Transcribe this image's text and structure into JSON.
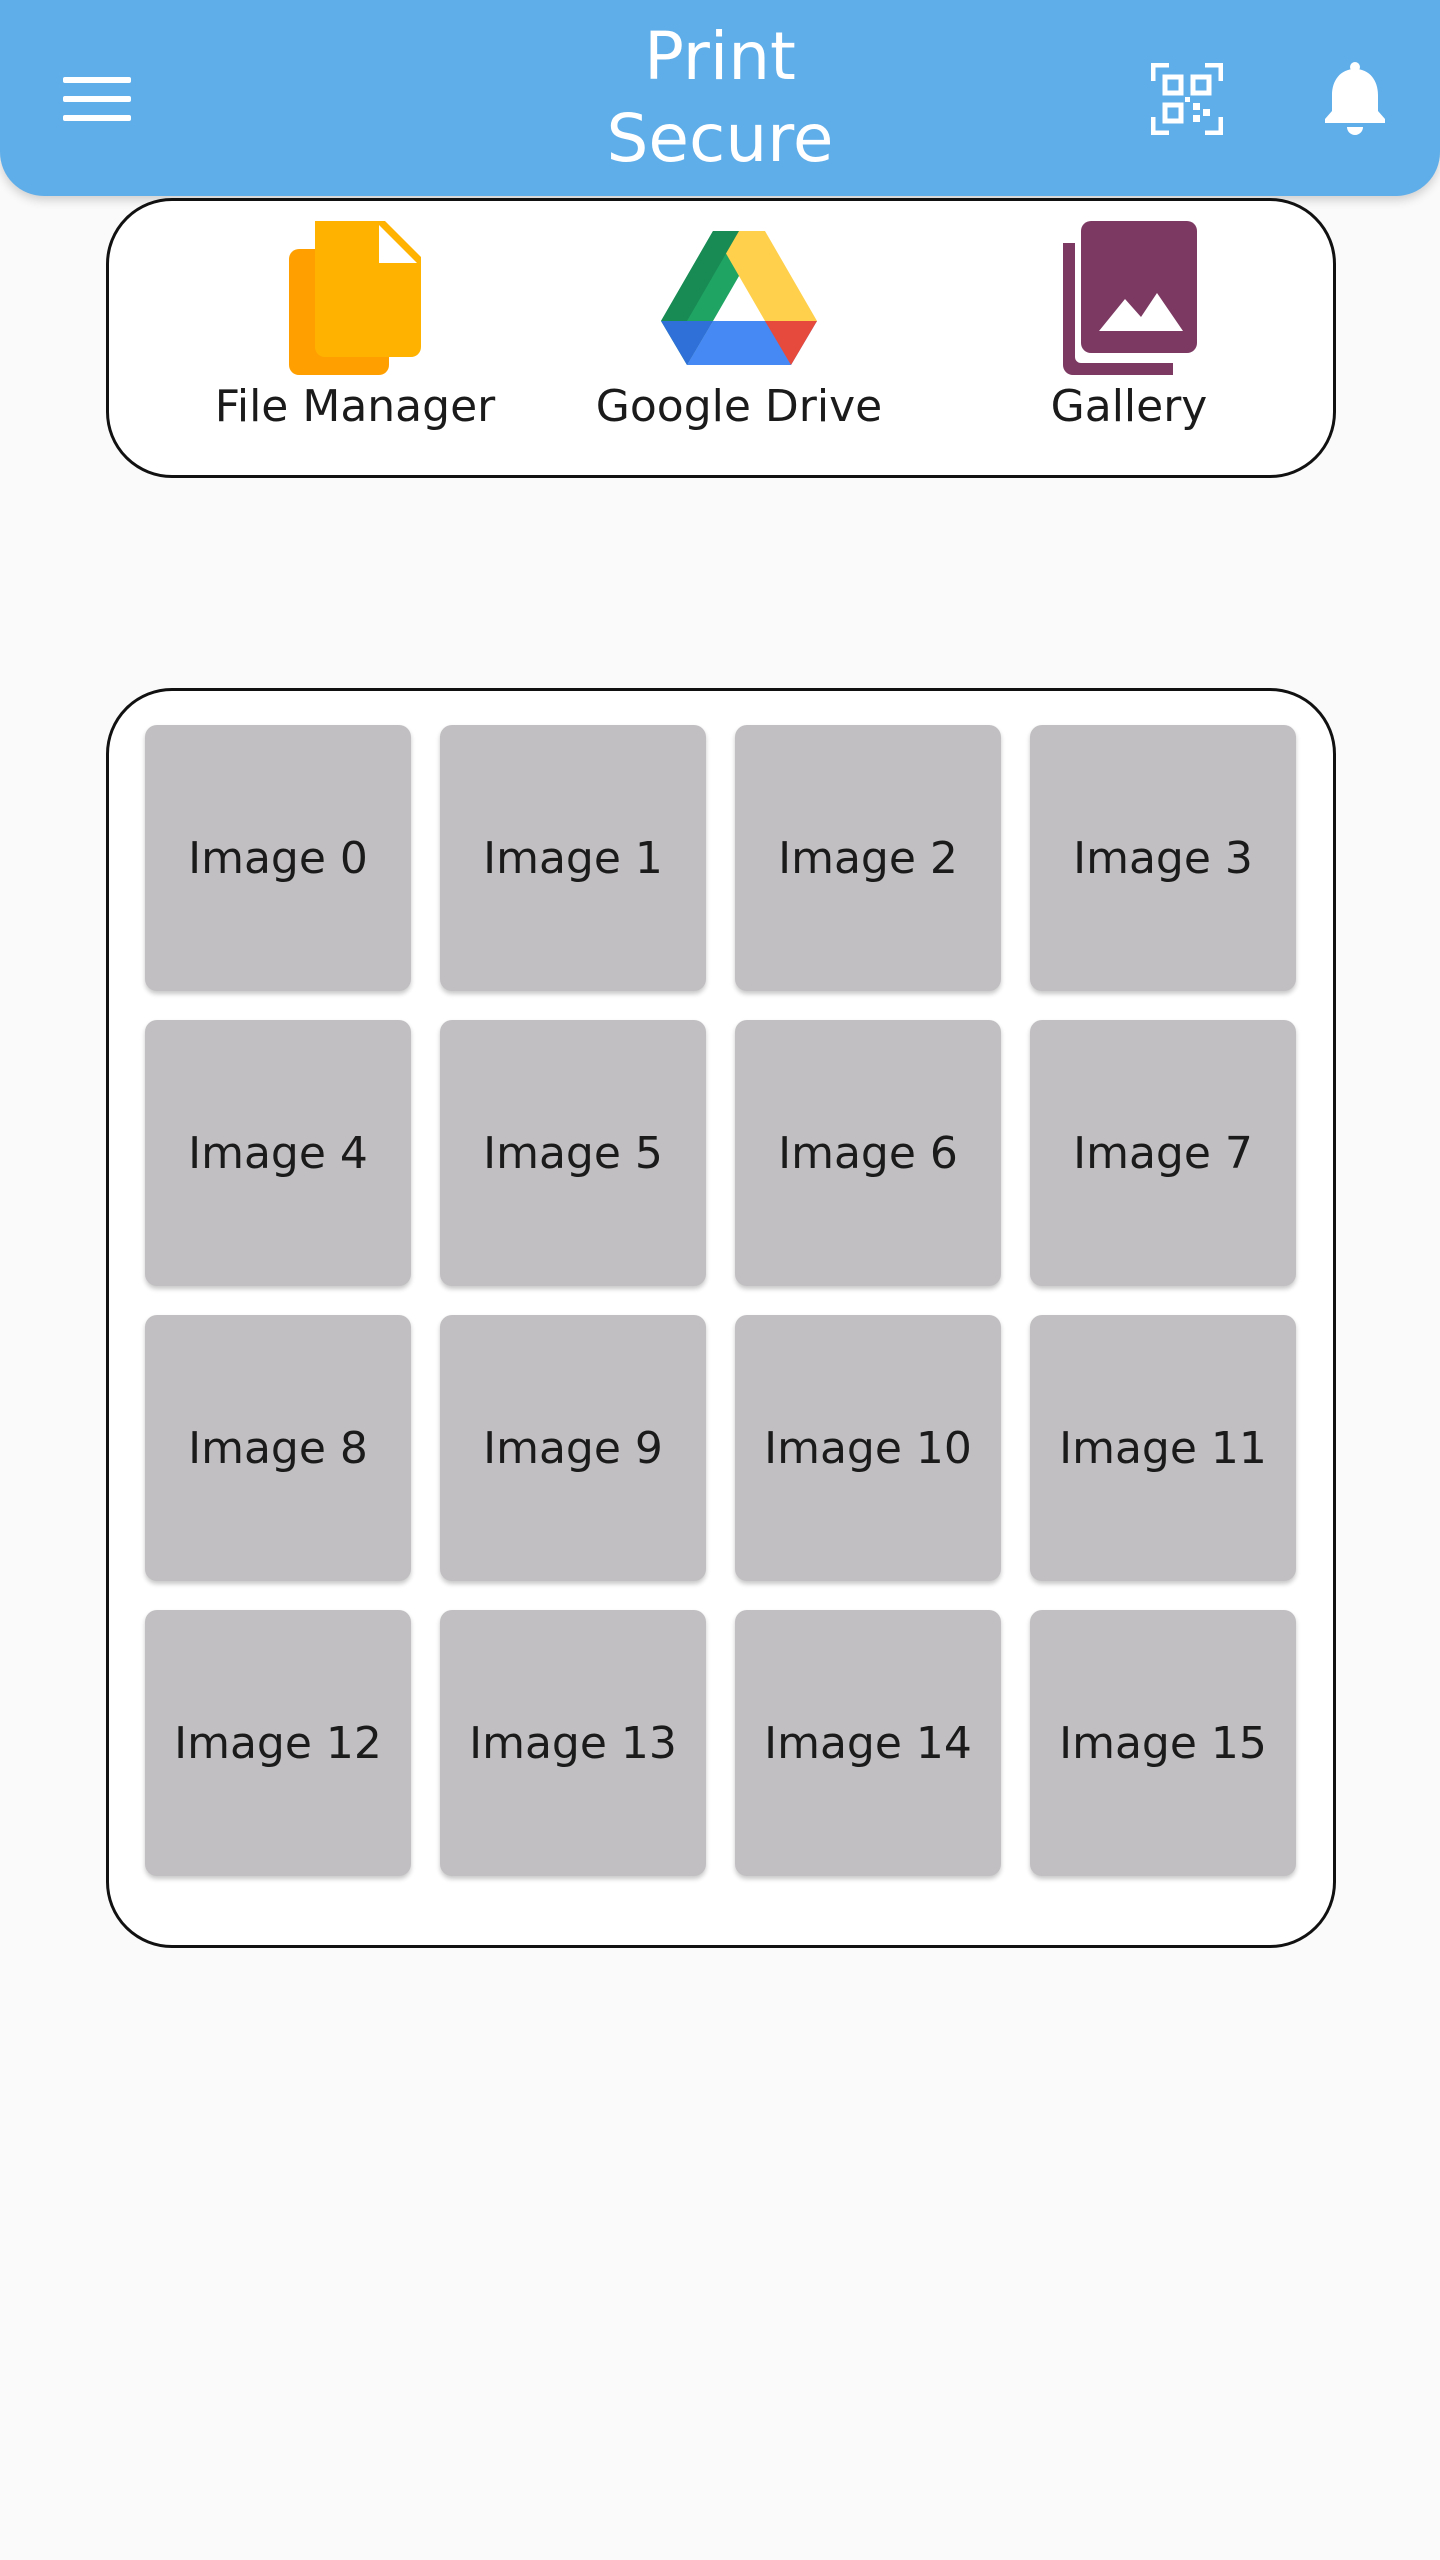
{
  "header": {
    "title": "Print\nSecure",
    "menu_icon": "menu-icon",
    "qr_icon": "qr-code-scan-icon",
    "bell_icon": "bell-icon",
    "color": "#5faeea"
  },
  "sources": [
    {
      "label": "File Manager",
      "icon": "file-manager-icon",
      "color": "#ffb300"
    },
    {
      "label": "Google Drive",
      "icon": "google-drive-icon",
      "color": "#1fa463"
    },
    {
      "label": "Gallery",
      "icon": "gallery-icon",
      "color": "#7c3961"
    }
  ],
  "images": [
    {
      "label": "Image 0"
    },
    {
      "label": "Image 1"
    },
    {
      "label": "Image 2"
    },
    {
      "label": "Image 3"
    },
    {
      "label": "Image 4"
    },
    {
      "label": "Image 5"
    },
    {
      "label": "Image 6"
    },
    {
      "label": "Image 7"
    },
    {
      "label": "Image 8"
    },
    {
      "label": "Image 9"
    },
    {
      "label": "Image 10"
    },
    {
      "label": "Image 11"
    },
    {
      "label": "Image 12"
    },
    {
      "label": "Image 13"
    },
    {
      "label": "Image 14"
    },
    {
      "label": "Image 15"
    }
  ]
}
